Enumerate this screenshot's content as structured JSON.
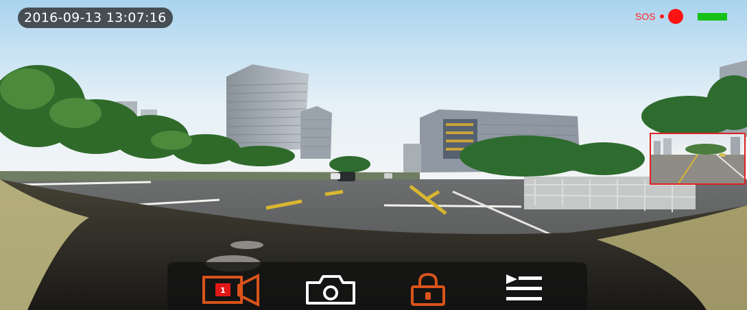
{
  "status": {
    "timestamp": "2016-09-13 13:07:16",
    "sos_label": "SOS",
    "recording": true,
    "battery_color": "#18c018"
  },
  "toolbar": {
    "buttons": [
      {
        "name": "record-video",
        "icon": "video-camera-icon",
        "badge": "1",
        "color": "#d9531a"
      },
      {
        "name": "take-photo",
        "icon": "camera-icon",
        "color": "#ffffff"
      },
      {
        "name": "lock-file",
        "icon": "lock-icon",
        "color": "#d9531a"
      },
      {
        "name": "playlist",
        "icon": "playlist-icon",
        "color": "#ffffff"
      }
    ]
  },
  "colors": {
    "accent": "#d9531a",
    "alert": "#ff1212",
    "toolbar_bg": "#121212"
  }
}
